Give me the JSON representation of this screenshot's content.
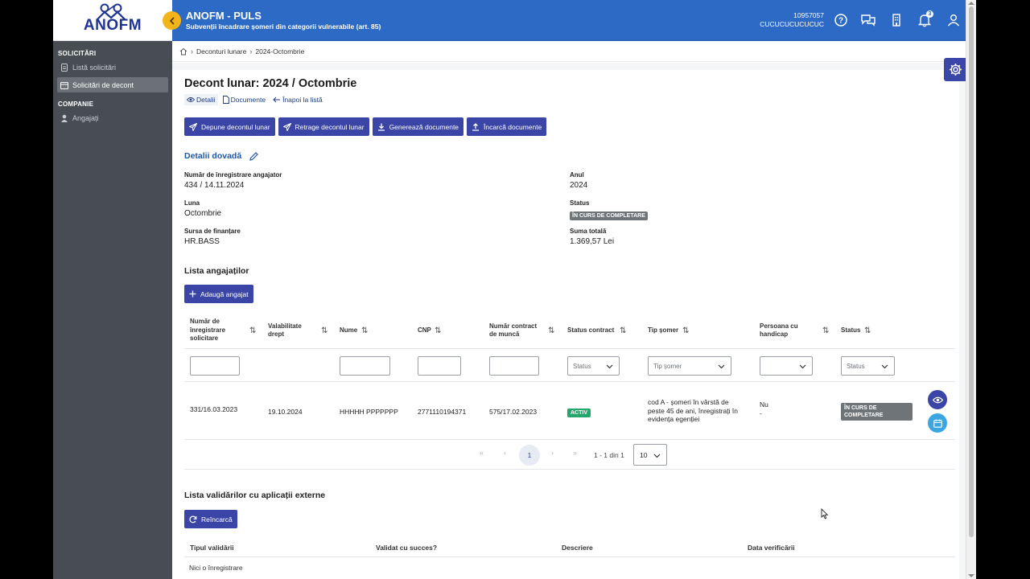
{
  "brand": {
    "logo_text": "ANOFM",
    "accent": "#2c6ac6",
    "button_color": "#3a45a6",
    "collapse_color": "#f2b419"
  },
  "sidebar": {
    "sections": [
      {
        "title": "SOLICITĂRI",
        "items": [
          {
            "label": "Listă solicitări",
            "icon": "document-icon",
            "active": false
          },
          {
            "label": "Solicitări de decont",
            "icon": "calendar-icon",
            "active": true
          }
        ]
      },
      {
        "title": "COMPANIE",
        "items": [
          {
            "label": "Angajați",
            "icon": "person-icon",
            "active": false
          }
        ]
      }
    ]
  },
  "header": {
    "title": "ANOFM - PULS",
    "subtitle": "Subvenții încadrare șomeri din categorii vulnerabile (art. 85)",
    "user_id": "10957057",
    "user_name": "CUCUCUCUCUCUC",
    "notification_count": "3",
    "icons": [
      "help-icon",
      "chat-icon",
      "building-icon",
      "bell-icon",
      "user-icon"
    ]
  },
  "breadcrumb": {
    "items": [
      "Deconturi lunare",
      "2024-Octombrie"
    ]
  },
  "page": {
    "title": "Decont lunar: 2024 / Octombrie",
    "tabs": [
      {
        "label": "Detalii",
        "icon": "eye-icon"
      },
      {
        "label": "Documente",
        "icon": "file-icon"
      },
      {
        "label": "Înapoi la listă",
        "icon": "arrow-left-icon"
      }
    ],
    "actions": [
      {
        "label": "Depune decontul lunar",
        "icon": "send-icon"
      },
      {
        "label": "Retrage decontul lunar",
        "icon": "send-icon"
      },
      {
        "label": "Generează documente",
        "icon": "download-icon"
      },
      {
        "label": "Încarcă documente",
        "icon": "upload-icon"
      }
    ]
  },
  "details": {
    "title": "Detalii dovadă",
    "reg_label": "Număr de înregistrare angajator",
    "reg_value": "434 / 14.11.2024",
    "year_label": "Anul",
    "year_value": "2024",
    "month_label": "Luna",
    "month_value": "Octombrie",
    "status_label": "Status",
    "status_value": "ÎN CURS DE COMPLETARE",
    "source_label": "Sursa de finanțare",
    "source_value": "HR.BASS",
    "total_label": "Suma totală",
    "total_value": "1.369,57 Lei"
  },
  "employees": {
    "title": "Lista angajaților",
    "add_label": "Adaugă angajat",
    "columns": [
      "Număr de înregistrare solicitare",
      "Valabilitate drept",
      "Nume",
      "CNP",
      "Număr contract de muncă",
      "Status contract",
      "Tip șomer",
      "Persoana cu handicap",
      "Status"
    ],
    "filters": {
      "status_contract": "Status",
      "tip_somer": "Tip șomer",
      "status": "Status"
    },
    "rows": [
      {
        "nr": "331/16.03.2023",
        "valabilitate": "19.10.2024",
        "nume": "HHHHH PPPPPPP",
        "cnp": "2771110194371",
        "contract": "575/17.02.2023",
        "status_contract": "ACTIV",
        "tip_somer": "cod A - șomeri în vârstă de peste 45 de ani, înregistrați în evidența egenției",
        "handicap": "Nu",
        "handicap_extra": "-",
        "status": "ÎN CURS DE COMPLETARE"
      }
    ],
    "pagination": {
      "current": "1",
      "info": "1 - 1 din 1",
      "page_size": "10"
    }
  },
  "validations": {
    "title": "Lista validărilor cu aplicații externe",
    "reload_label": "Reîncarcă",
    "columns": [
      "Tipul validării",
      "Validat cu succes?",
      "Descriere",
      "Data verificării"
    ],
    "empty": "Nici o înregistrare"
  }
}
